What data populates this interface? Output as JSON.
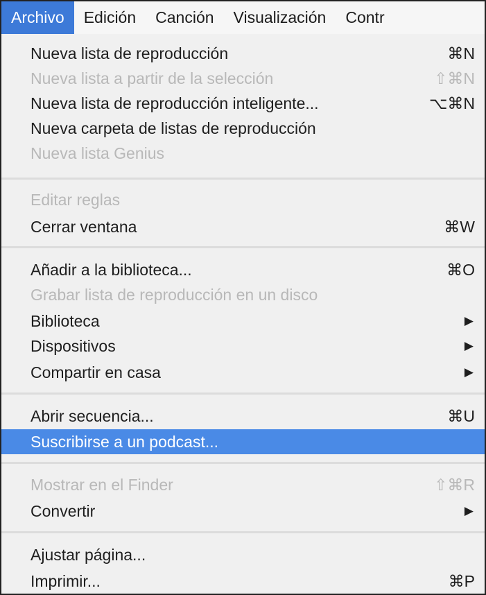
{
  "menubar": {
    "archivo": "Archivo",
    "edicion": "Edición",
    "cancion": "Canción",
    "visualizacion": "Visualización",
    "controles": "Contr"
  },
  "menu": {
    "nueva_lista": {
      "label": "Nueva lista de reproducción",
      "shortcut": "⌘N"
    },
    "nueva_lista_seleccion": {
      "label": "Nueva lista a partir de la selección",
      "shortcut": "⇧⌘N"
    },
    "nueva_lista_inteligente": {
      "label": "Nueva lista de reproducción inteligente...",
      "shortcut": "⌥⌘N"
    },
    "nueva_carpeta": {
      "label": "Nueva carpeta de listas de reproducción"
    },
    "nueva_genius": {
      "label": "Nueva lista Genius"
    },
    "editar_reglas": {
      "label": "Editar reglas"
    },
    "cerrar_ventana": {
      "label": "Cerrar ventana",
      "shortcut": "⌘W"
    },
    "anadir_biblioteca": {
      "label": "Añadir a la biblioteca...",
      "shortcut": "⌘O"
    },
    "grabar_lista": {
      "label": "Grabar lista de reproducción en un disco"
    },
    "biblioteca": {
      "label": "Biblioteca",
      "arrow": "▶"
    },
    "dispositivos": {
      "label": "Dispositivos",
      "arrow": "▶"
    },
    "compartir_casa": {
      "label": "Compartir en casa",
      "arrow": "▶"
    },
    "abrir_secuencia": {
      "label": "Abrir secuencia...",
      "shortcut": "⌘U"
    },
    "suscribirse_podcast": {
      "label": "Suscribirse a un podcast..."
    },
    "mostrar_finder": {
      "label": "Mostrar en el Finder",
      "shortcut": "⇧⌘R"
    },
    "convertir": {
      "label": "Convertir",
      "arrow": "▶"
    },
    "ajustar_pagina": {
      "label": "Ajustar página..."
    },
    "imprimir": {
      "label": "Imprimir...",
      "shortcut": "⌘P"
    }
  }
}
